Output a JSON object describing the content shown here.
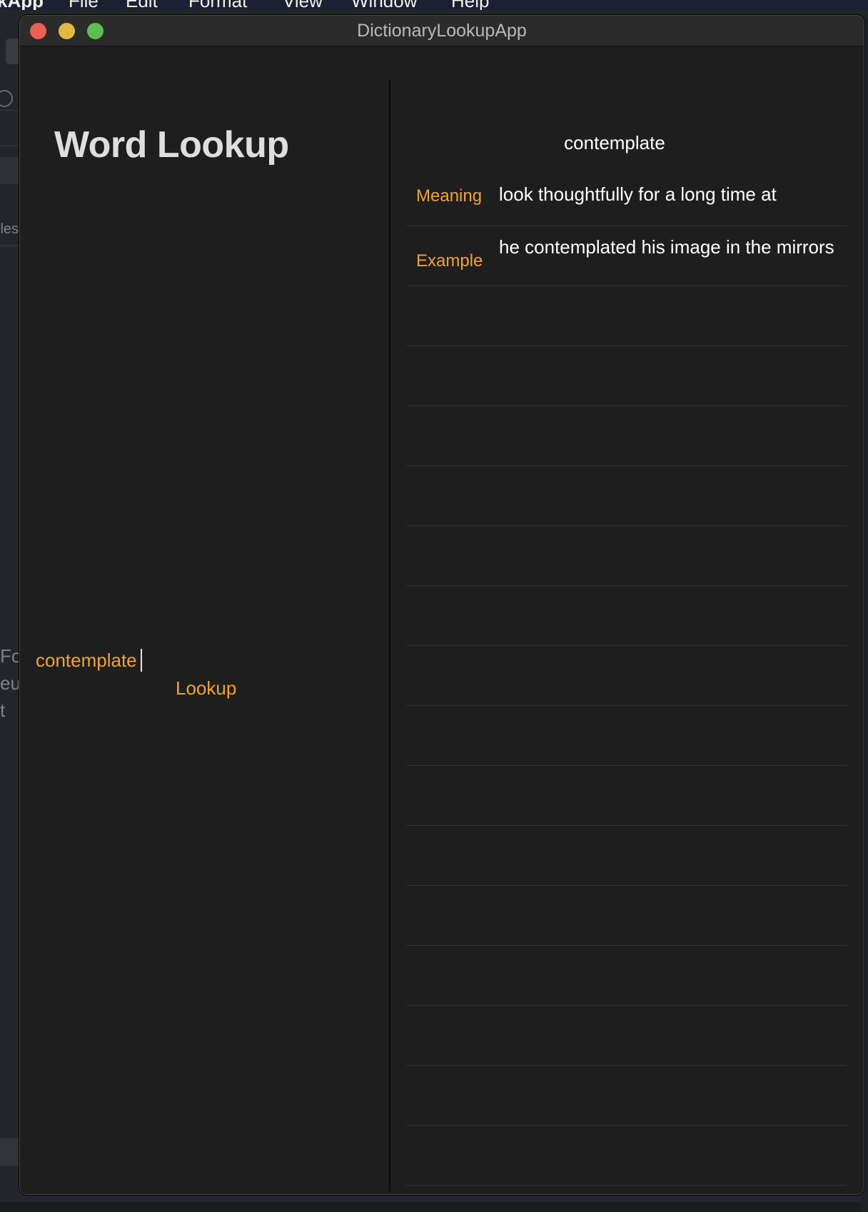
{
  "menubar": {
    "app_name": "kApp",
    "items": [
      "File",
      "Edit",
      "Format",
      "View",
      "Window",
      "Help"
    ]
  },
  "background_app": {
    "sidebar_text": "iles",
    "editor_fragments": [
      "Fo",
      "eu",
      "t"
    ]
  },
  "window": {
    "title": "DictionaryLookupApp"
  },
  "left_panel": {
    "heading": "Word Lookup",
    "input_value": "contemplate",
    "lookup_button_label": "Lookup"
  },
  "result": {
    "word": "contemplate",
    "rows": [
      {
        "label": "Meaning",
        "value": "look thoughtfully for a long time at"
      },
      {
        "label": "Example",
        "value": "he contemplated his image in the mirrors"
      }
    ],
    "empty_rows": 15
  },
  "colors": {
    "accent": "#f0a33a",
    "window_bg": "#1e1e1e",
    "titlebar_bg": "#2b2b2b",
    "separator": "#333333"
  }
}
